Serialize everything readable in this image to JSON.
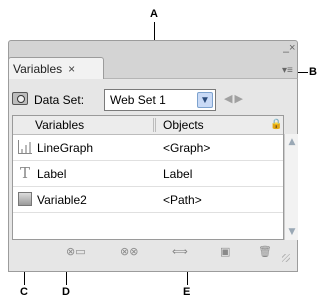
{
  "callouts": {
    "a": "A",
    "b": "B",
    "c": "C",
    "d": "D",
    "e": "E"
  },
  "panel": {
    "tab_title": "Variables",
    "tab_close": "×",
    "minimize": "–",
    "close": "×",
    "menu_icon": "▾≡"
  },
  "dataset": {
    "label": "Data Set:",
    "selected": "Web Set 1",
    "dropdown_icon": "chevron-down-icon",
    "prev_icon": "◀",
    "next_icon": "▶"
  },
  "table": {
    "columns": [
      "Variables",
      "Objects"
    ],
    "rows": [
      {
        "icon": "graph-icon",
        "variable": "LineGraph",
        "object": "<Graph>"
      },
      {
        "icon": "text-icon",
        "variable": "Label",
        "object": "Label",
        "icon_glyph": "T"
      },
      {
        "icon": "pixel-replacement-icon",
        "variable": "Variable2",
        "object": "<Path>"
      }
    ]
  },
  "scrollbar": {
    "up": "▲",
    "down": "▼"
  },
  "bottom_toolbar": {
    "icons": [
      "capture-dataset-icon",
      "make-dynamic-icon",
      "unbind-variable-icon",
      "new-variable-icon",
      "delete-variable-icon"
    ],
    "glyphs": [
      "⊗▭",
      "⊗⊗",
      "⟺",
      "▣",
      "🗑"
    ]
  }
}
